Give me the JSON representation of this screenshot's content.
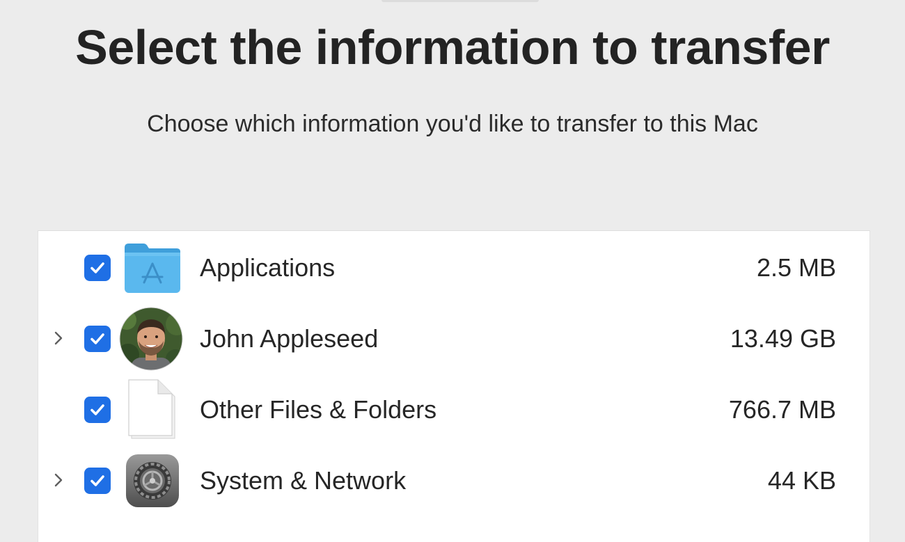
{
  "page": {
    "title": "Select the information to transfer",
    "subtitle": "Choose which information you'd like to transfer to this Mac"
  },
  "items": [
    {
      "label": "Applications",
      "size": "2.5 MB",
      "checked": true,
      "expandable": false,
      "icon": "applications-folder-icon"
    },
    {
      "label": "John Appleseed",
      "size": "13.49 GB",
      "checked": true,
      "expandable": true,
      "icon": "user-avatar"
    },
    {
      "label": "Other Files & Folders",
      "size": "766.7 MB",
      "checked": true,
      "expandable": false,
      "icon": "document-icon"
    },
    {
      "label": "System & Network",
      "size": "44 KB",
      "checked": true,
      "expandable": true,
      "icon": "system-preferences-gear-icon"
    }
  ],
  "colors": {
    "background": "#ececec",
    "panel": "#ffffff",
    "checkbox_accent": "#1f6fe5",
    "folder_blue": "#5ab8ee"
  }
}
